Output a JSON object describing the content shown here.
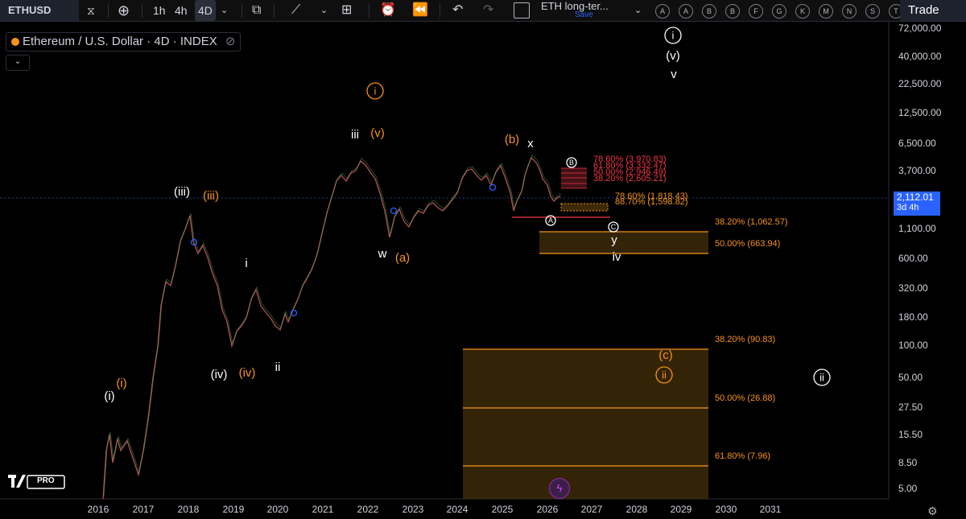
{
  "toolbar": {
    "symbol": "ETHUSD",
    "timeframes": [
      "1h",
      "4h",
      "4D"
    ],
    "active_timeframe": "4D",
    "layout_name": "ETH long-ter...",
    "save_label": "Save",
    "alert_letters": [
      "A",
      "A",
      "B",
      "B",
      "F",
      "G",
      "K",
      "M",
      "N",
      "S",
      "T"
    ],
    "trade_label": "Trade"
  },
  "legend": {
    "title": "Ethereum / U.S. Dollar · 4D · INDEX"
  },
  "price_axis": {
    "ticks": [
      "72,000.00",
      "40,000.00",
      "22,500.00",
      "12,500.00",
      "6,500.00",
      "3,700.00",
      "2,112.01",
      "1,100.00",
      "600.00",
      "320.00",
      "180.00",
      "100.00",
      "50.00",
      "27.50",
      "15.50",
      "8.50",
      "5.00"
    ],
    "current_price": "2,112.01",
    "current_interval": "3d 4h"
  },
  "time_axis": {
    "years": [
      "2016",
      "2017",
      "2018",
      "2019",
      "2020",
      "2021",
      "2022",
      "2023",
      "2024",
      "2025",
      "2026",
      "2027",
      "2028",
      "2029",
      "2030",
      "2031"
    ]
  },
  "wave_labels": {
    "black": [
      "(i)",
      "(iii)",
      "(iv)",
      "i",
      "ii",
      "iii",
      "w",
      "x",
      "y",
      "iv",
      "(v)",
      "v"
    ],
    "orange": [
      "(i)",
      "(iii)",
      "(iv)",
      "(v)",
      "(a)",
      "(b)",
      "(c)"
    ],
    "circled_orange": [
      "i",
      "ii"
    ],
    "circled_white": [
      "i",
      "ii"
    ],
    "circled_small": [
      "A",
      "B",
      "C"
    ]
  },
  "fib_levels": {
    "upper_box": [
      "78.60% (3,970.83)",
      "61.80% (3,332.47)",
      "50.00% (2,946.49)",
      "38.20% (2,605.21)"
    ],
    "mid_box": [
      "78.60% (1,818.43)",
      "88.70% (1,598.82)"
    ],
    "support_box": [
      "38.20% (1,062.57)",
      "50.00% (663.94)"
    ],
    "deep_box": [
      "38.20% (90.83)",
      "50.00% (26.88)",
      "61.80% (7.96)"
    ]
  },
  "colors": {
    "background": "#000000",
    "orange": "#f7931a",
    "fib_red": "#f23645",
    "price_label": "#2962ff"
  },
  "icons": [
    "chevron-down-icon",
    "plus-icon",
    "candle-icon",
    "indicator-icon",
    "layout-icon",
    "alert-icon",
    "replay-icon",
    "undo-icon",
    "redo-icon",
    "gear-icon",
    "lightning-icon"
  ]
}
